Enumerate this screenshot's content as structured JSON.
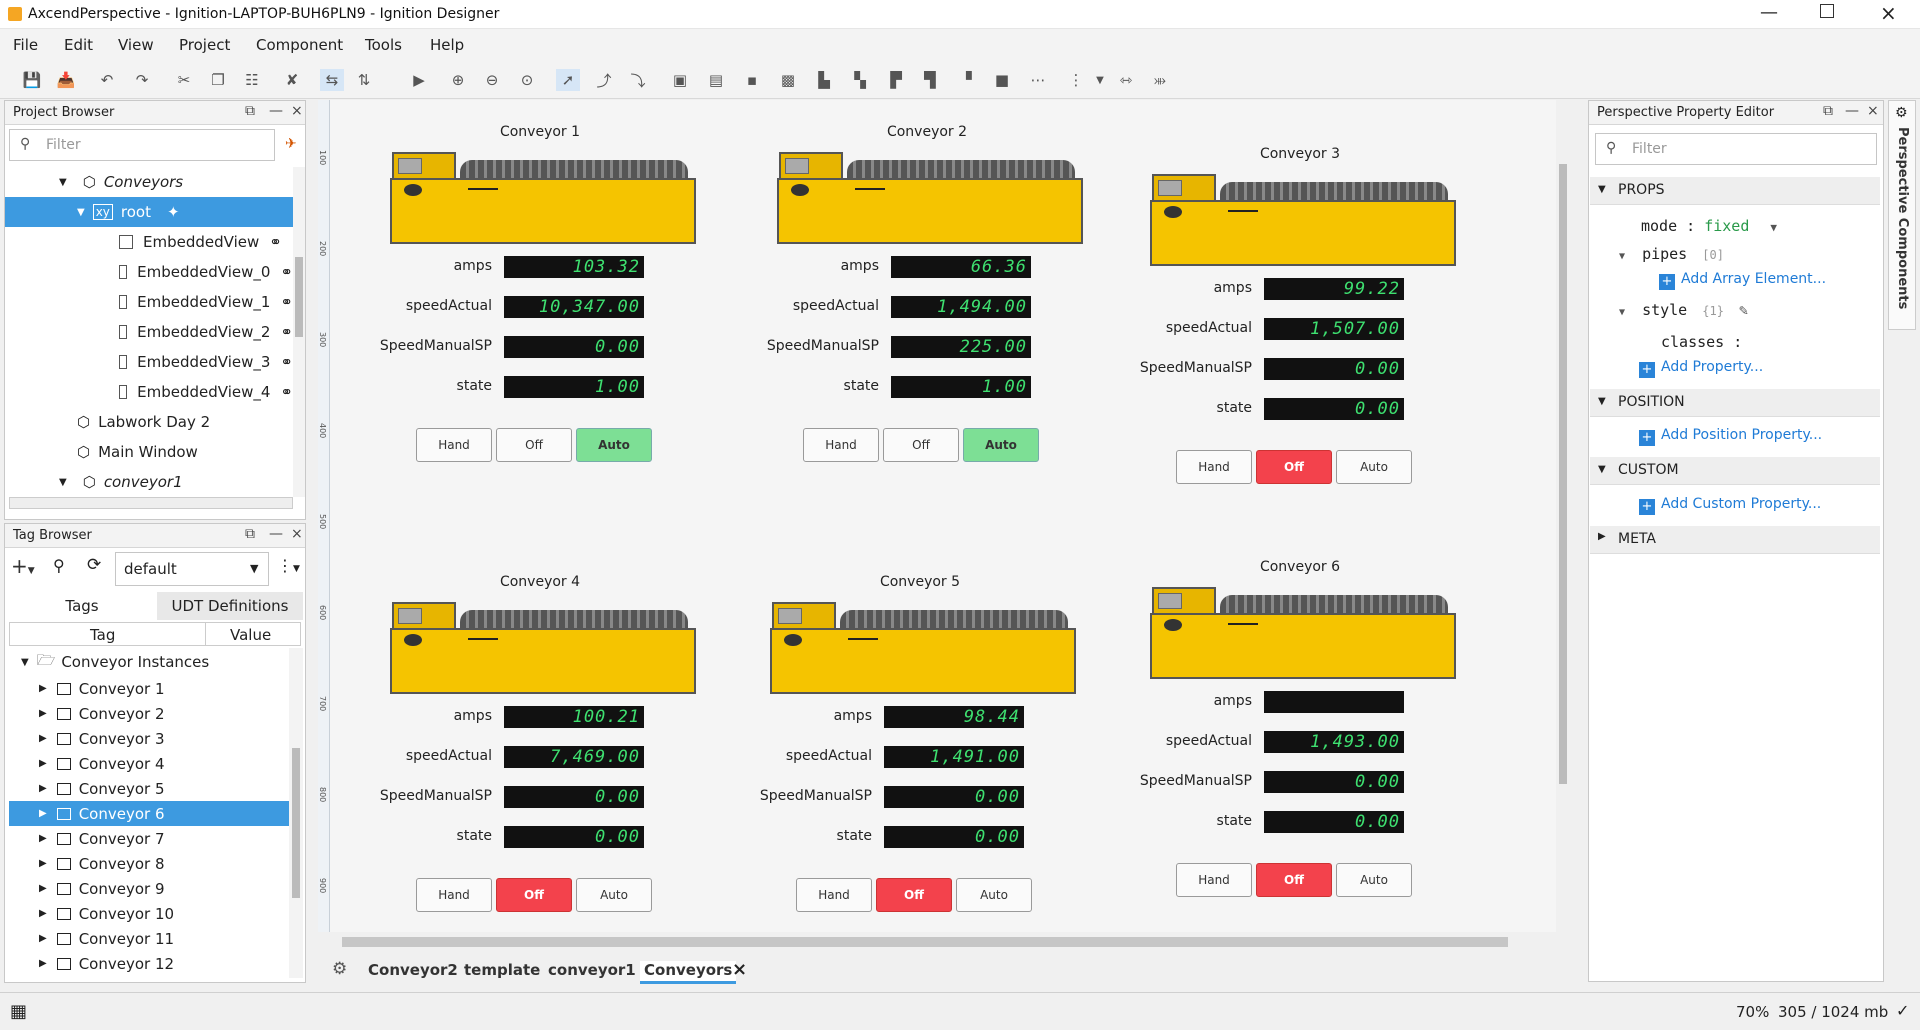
{
  "window": {
    "title": "AxcendPerspective - Ignition-LAPTOP-BUH6PLN9 - Ignition Designer"
  },
  "menu": [
    "File",
    "Edit",
    "View",
    "Project",
    "Component",
    "Tools",
    "Help"
  ],
  "project_browser": {
    "title": "Project Browser",
    "filter_placeholder": "Filter",
    "items": [
      {
        "label": "Conveyors",
        "indent": 1
      },
      {
        "label": "root",
        "indent": 2
      },
      {
        "label": "EmbeddedView",
        "indent": 3
      },
      {
        "label": "EmbeddedView_0",
        "indent": 3
      },
      {
        "label": "EmbeddedView_1",
        "indent": 3
      },
      {
        "label": "EmbeddedView_2",
        "indent": 3
      },
      {
        "label": "EmbeddedView_3",
        "indent": 3
      },
      {
        "label": "EmbeddedView_4",
        "indent": 3
      },
      {
        "label": "Labwork Day 2",
        "indent": 1
      },
      {
        "label": "Main Window",
        "indent": 1
      },
      {
        "label": "conveyor1",
        "indent": 1
      }
    ]
  },
  "tag_browser": {
    "title": "Tag Browser",
    "provider": "default",
    "tabs": [
      "Tags",
      "UDT Definitions"
    ],
    "col_tag": "Tag",
    "col_value": "Value",
    "folder": "Conveyor Instances",
    "items": [
      "Conveyor 1",
      "Conveyor 2",
      "Conveyor 3",
      "Conveyor 4",
      "Conveyor 5",
      "Conveyor 6",
      "Conveyor 7",
      "Conveyor 8",
      "Conveyor 9",
      "Conveyor 10",
      "Conveyor 11",
      "Conveyor 12"
    ],
    "selected": "Conveyor 6"
  },
  "conveyors": [
    {
      "title": "Conveyor 1",
      "amps": "103.32",
      "speedActual": "10,347.00",
      "SpeedManualSP": "0.00",
      "state": "1.00",
      "mode": "Auto"
    },
    {
      "title": "Conveyor 2",
      "amps": "66.36",
      "speedActual": "1,494.00",
      "SpeedManualSP": "225.00",
      "state": "1.00",
      "mode": "Auto"
    },
    {
      "title": "Conveyor 3",
      "amps": "99.22",
      "speedActual": "1,507.00",
      "SpeedManualSP": "0.00",
      "state": "0.00",
      "mode": "Off"
    },
    {
      "title": "Conveyor 4",
      "amps": "100.21",
      "speedActual": "7,469.00",
      "SpeedManualSP": "0.00",
      "state": "0.00",
      "mode": "Off"
    },
    {
      "title": "Conveyor 5",
      "amps": "98.44",
      "speedActual": "1,491.00",
      "SpeedManualSP": "0.00",
      "state": "0.00",
      "mode": "Off"
    },
    {
      "title": "Conveyor 6",
      "amps": "",
      "speedActual": "1,493.00",
      "SpeedManualSP": "0.00",
      "state": "0.00",
      "mode": "Off"
    }
  ],
  "labels": {
    "amps": "amps",
    "speedActual": "speedActual",
    "SpeedManualSP": "SpeedManualSP",
    "state": "state",
    "hand": "Hand",
    "off": "Off",
    "auto": "Auto"
  },
  "property_editor": {
    "title": "Perspective Property Editor",
    "filter_placeholder": "Filter",
    "props": "PROPS",
    "mode_key": "mode",
    "mode_val": "fixed",
    "pipes_key": "pipes",
    "pipes_count": "[0]",
    "add_array": "Add Array Element...",
    "style_key": "style",
    "style_count": "{1}",
    "classes_key": "classes",
    "add_property": "Add Property...",
    "position": "POSITION",
    "add_position": "Add Position Property...",
    "custom": "CUSTOM",
    "add_custom": "Add Custom Property...",
    "meta": "META",
    "side_tab": "Perspective Components"
  },
  "bottom_tabs": [
    "Conveyor2",
    "template",
    "conveyor1",
    "Conveyors"
  ],
  "active_tab": "Conveyors",
  "status": {
    "zoom": "70%",
    "memory": "305 / 1024 mb"
  },
  "ruler": [
    "100",
    "200",
    "300",
    "400",
    "500",
    "600",
    "700",
    "800",
    "900"
  ]
}
